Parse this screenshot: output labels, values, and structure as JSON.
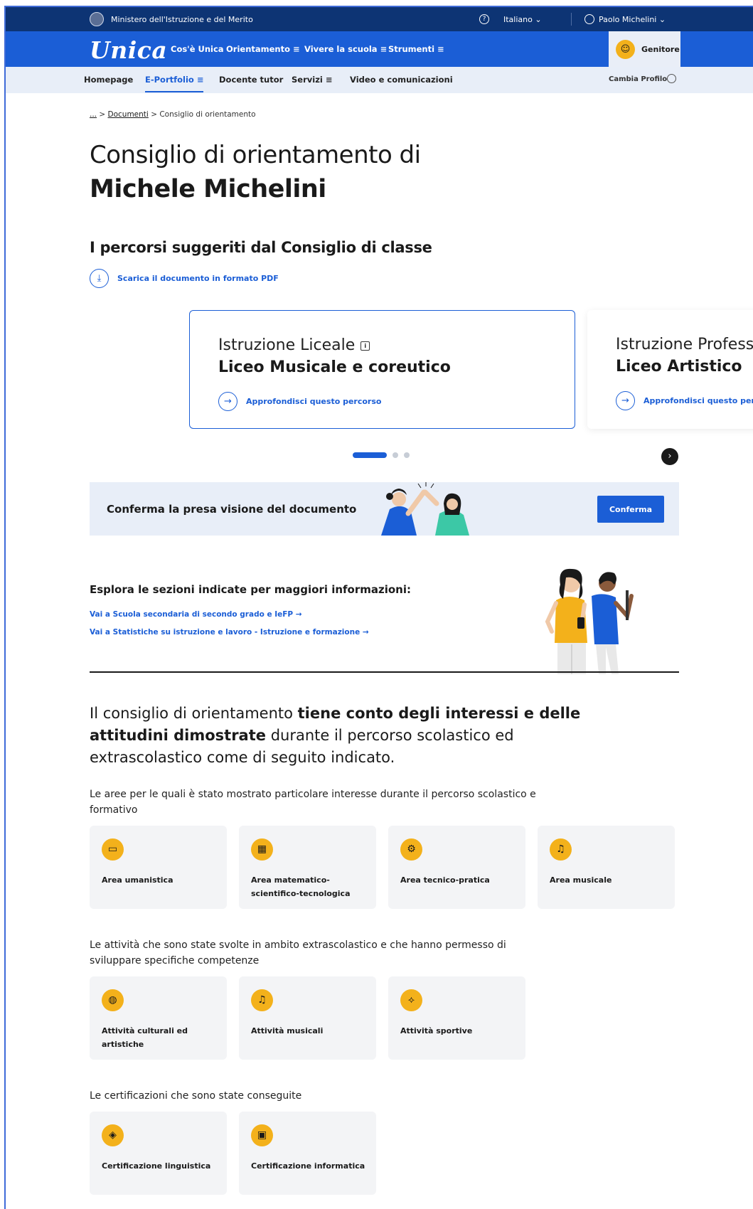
{
  "ministry_bar": {
    "title": "Ministero dell'Istruzione e del Merito",
    "language": "Italiano  ⌄",
    "user": "Paolo Michelini  ⌄"
  },
  "main_nav": {
    "logo": "Unica",
    "items": [
      "Cos'è Unica",
      "Orientamento  ≡",
      "Vivere la scuola  ≡",
      "Strumenti  ≡"
    ],
    "role": "Genitore"
  },
  "sub_nav": {
    "items": [
      "Homepage",
      "E-Portfolio  ≡",
      "Docente tutor",
      "Servizi  ≡",
      "Video e comunicazioni"
    ],
    "change_profile": "Cambia Profilo"
  },
  "breadcrumb": {
    "ellipsis": "...",
    "sep": ">",
    "documents": "Documenti",
    "current": "Consiglio di orientamento"
  },
  "page_title": {
    "line1": "Consiglio di orientamento di",
    "line2": "Michele Michelini"
  },
  "suggested": {
    "heading": "I percorsi suggeriti dal Consiglio di classe",
    "download_label": "Scarica il documento in formato PDF",
    "cards": [
      {
        "type": "Istruzione Liceale",
        "name": "Liceo Musicale e coreutico",
        "link": "Approfondisci questo percorso"
      },
      {
        "type": "Istruzione Professionale",
        "name": "Liceo Artistico",
        "link": "Approfondisci questo percorso"
      }
    ],
    "carousel_active": 1,
    "carousel_count": 3
  },
  "confirm": {
    "text": "Conferma la presa visione del documento",
    "button": "Conferma"
  },
  "explore": {
    "heading": "Esplora le sezioni indicate per maggiori informazioni:",
    "links": [
      "Vai a Scuola secondaria di secondo grado e IeFP  →",
      "Vai a Statistiche su istruzione e lavoro - Istruzione e formazione  →"
    ]
  },
  "intro": {
    "a": "Il consiglio di orientamento ",
    "b": "tiene conto degli interessi e delle attitudini dimostrate",
    "c": " durante il percorso scolastico ed extrascolastico come di seguito indicato."
  },
  "interests": {
    "text": "Le aree per le quali è stato mostrato particolare interesse durante il percorso scolastico e formativo",
    "tiles": [
      "Area umanistica",
      "Area matematico-scientifico-tecnologica",
      "Area tecnico-pratica",
      "Area musicale"
    ]
  },
  "activities": {
    "text": "Le attività che sono state svolte in ambito extrascolastico e che hanno permesso di sviluppare specifiche competenze",
    "tiles": [
      "Attività culturali ed artistiche",
      "Attività musicali",
      "Attività sportive"
    ]
  },
  "certifications": {
    "text": "Le certificazioni che sono state conseguite",
    "tiles": [
      "Certificazione linguistica",
      "Certificazione informatica"
    ]
  },
  "colors": {
    "primary": "#1b5ed6",
    "ministry": "#0d3474",
    "accent": "#f3b11b",
    "subnav_bg": "#e8eef8",
    "tile_bg": "#f3f4f6"
  },
  "icons": {
    "tiles": [
      "book-icon",
      "calculator-icon",
      "gears-icon",
      "music-note-icon",
      "palette-icon",
      "music-note-icon",
      "running-shoe-icon",
      "language-icon",
      "computer-icon"
    ]
  }
}
